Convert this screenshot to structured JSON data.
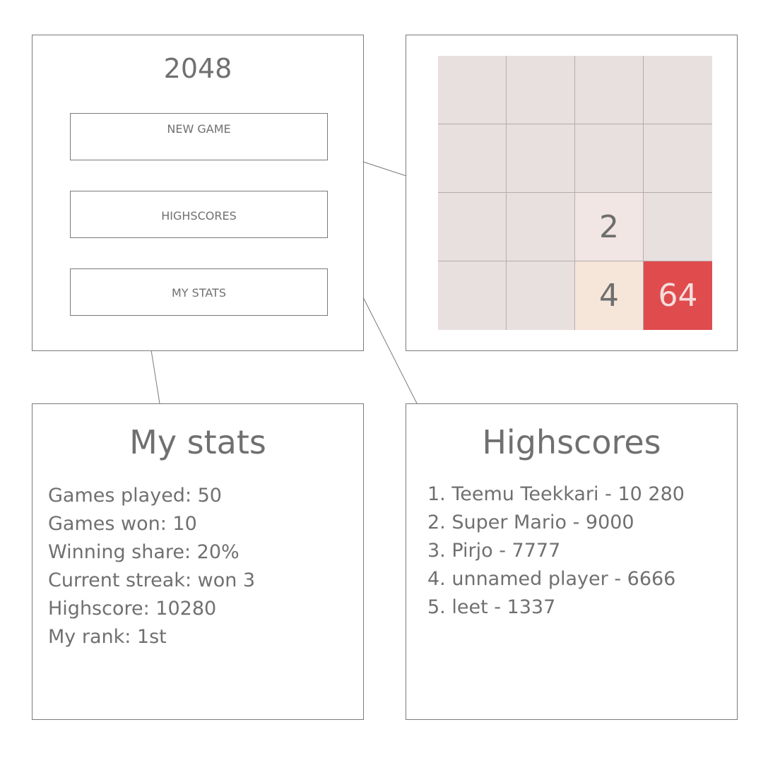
{
  "menu": {
    "title": "2048",
    "buttons": {
      "new_game": "NEW GAME",
      "highscores": "HIGHSCORES",
      "my_stats": "MY STATS"
    }
  },
  "board": {
    "cells": [
      {
        "value": "",
        "color": "#e8dfdf"
      },
      {
        "value": "",
        "color": "#e8dfdf"
      },
      {
        "value": "",
        "color": "#e8dfdf"
      },
      {
        "value": "",
        "color": "#e8dfdf"
      },
      {
        "value": "",
        "color": "#e8dfdf"
      },
      {
        "value": "",
        "color": "#e8dfdf"
      },
      {
        "value": "",
        "color": "#e8dfdf"
      },
      {
        "value": "",
        "color": "#e8dfdf"
      },
      {
        "value": "",
        "color": "#e8dfdf"
      },
      {
        "value": "",
        "color": "#e8dfdf"
      },
      {
        "value": "2",
        "color": "#f2e6e5"
      },
      {
        "value": "",
        "color": "#e8dfdf"
      },
      {
        "value": "",
        "color": "#e8dfdf"
      },
      {
        "value": "",
        "color": "#e8dfdf"
      },
      {
        "value": "4",
        "color": "#f6e5d9"
      },
      {
        "value": "64",
        "color": "#e04c4e",
        "text_color": "#f3dede"
      }
    ]
  },
  "stats": {
    "title": "My stats",
    "lines": [
      "Games played: 50",
      "Games won: 10",
      "Winning share: 20%",
      "Current streak: won 3",
      "Highscore: 10280",
      "My rank: 1st"
    ]
  },
  "highscores": {
    "title": "Highscores",
    "entries": [
      "1. Teemu Teekkari - 10 280",
      "2. Super Mario - 9000",
      "3. Pirjo - 7777",
      "4. unnamed player - 6666",
      "5. leet - 1337"
    ]
  }
}
